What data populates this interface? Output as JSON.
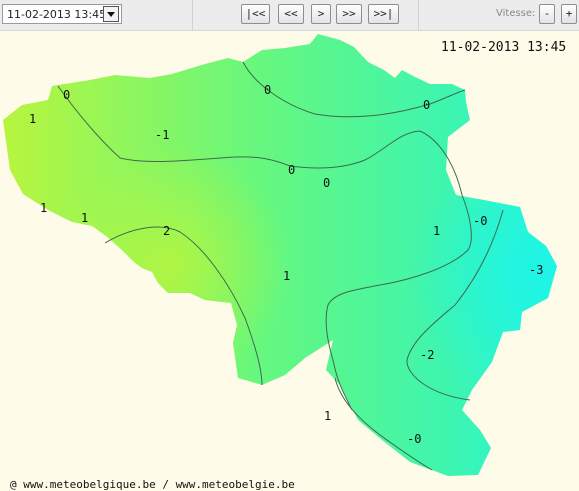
{
  "toolbar": {
    "datetime_select": {
      "value": "11-02-2013 13:45"
    },
    "nav_buttons": {
      "first": "|<<",
      "prev": "<<",
      "play": ">",
      "next": ">>",
      "last": ">>|"
    },
    "speed_label": "Vitesse:",
    "speed_buttons": {
      "minus": "-",
      "plus": "+"
    }
  },
  "map": {
    "timestamp": "11-02-2013 13:45",
    "isoline_labels": [
      "0",
      "0",
      "0",
      "1",
      "-1",
      "0",
      "0",
      "1",
      "1",
      "-0",
      "2",
      "1",
      "1",
      "-3",
      "-2",
      "1",
      "-0"
    ],
    "credit": "@ www.meteobelgique.be / www.meteobelgie.be",
    "colors": {
      "warm": "#b8f53d",
      "mid": "#66f77e",
      "cool": "#3df5b0",
      "cold": "#1ef5e6",
      "background": "#fffbe9",
      "contour": "#3f6a4f"
    }
  }
}
